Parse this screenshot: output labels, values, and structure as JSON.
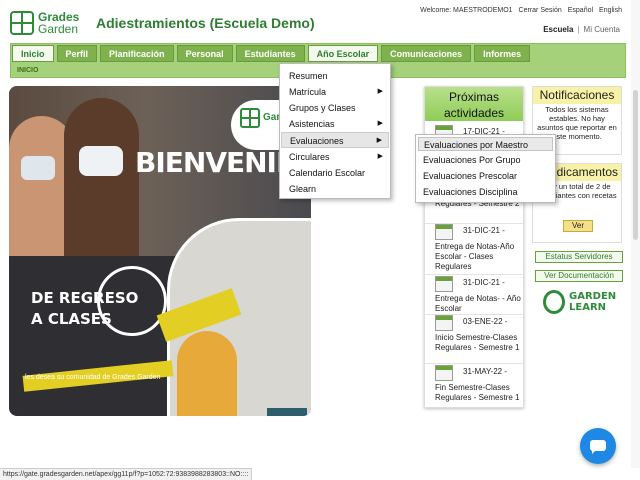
{
  "header": {
    "logo_line1": "Grades",
    "logo_line2": "Garden",
    "title": "Adiestramientos (Escuela Demo)",
    "welcome": "Welcome: MAESTRODEMO1",
    "logout": "Cerrar Sesión",
    "lang_es": "Español",
    "lang_en": "English",
    "school": "Escuela",
    "separator": "|",
    "my_account": "Mi Cuenta"
  },
  "nav": {
    "tabs": [
      {
        "label": "Inicio",
        "state": "active"
      },
      {
        "label": "Perfil"
      },
      {
        "label": "Planificación"
      },
      {
        "label": "Personal"
      },
      {
        "label": "Estudiantes"
      },
      {
        "label": "Año Escolar",
        "state": "open"
      },
      {
        "label": "Comunicaciones"
      },
      {
        "label": "Informes"
      }
    ],
    "breadcrumb": "INICIO"
  },
  "hero": {
    "welcome_text": "BIENVENIDO",
    "watermark_text": "Gar",
    "headline_line1": "DE REGRESO",
    "headline_line2": "A CLASES",
    "tagline": "les desea su comunidad de Grades Garden"
  },
  "activities": {
    "title_line1": "Próximas",
    "title_line2": "actividades",
    "items": [
      {
        "date": "17-DIC-21 -",
        "desc": ""
      },
      {
        "date": "",
        "desc": "Regulares - Semestre 2"
      },
      {
        "date": "31-DIC-21 -",
        "desc": "Entrega de Notas-Año Escolar - Clases Regulares"
      },
      {
        "date": "31-DIC-21 -",
        "desc": "Entrega de Notas- - Año Escolar"
      },
      {
        "date": "03-ENE-22 -",
        "desc": "Inicio Semestre-Clases Regulares - Semestre 1"
      },
      {
        "date": "31-MAY-22 -",
        "desc": "Fin Semestre-Clases Regulares - Semestre 1"
      }
    ]
  },
  "notifications": {
    "title": "Notificaciones",
    "body": "Todos los sistemas estables. No hay asuntos que reportar en este momento."
  },
  "medications": {
    "title": "edicamentos",
    "body": "Hay un total de 2 de estudiantes con recetas",
    "button": "Ver"
  },
  "side_buttons": {
    "server_status": "Estatus Servidores",
    "docs": "Ver Documentación"
  },
  "garden_learn": {
    "line1": "GARDEN",
    "line2": "LEARN"
  },
  "menu": {
    "items": [
      {
        "label": "Resumen",
        "arrow": ""
      },
      {
        "label": "Matrícula",
        "arrow": "▶"
      },
      {
        "label": "Grupos y Clases",
        "arrow": ""
      },
      {
        "label": "Asistencias",
        "arrow": "▶"
      },
      {
        "label": "Evaluaciones",
        "arrow": "▶"
      },
      {
        "label": "Circulares",
        "arrow": "▶"
      },
      {
        "label": "Calendario Escolar",
        "arrow": ""
      },
      {
        "label": "Glearn",
        "arrow": ""
      }
    ]
  },
  "submenu": {
    "items": [
      "Evaluaciones por Maestro",
      "Evaluaciones Por Grupo",
      "Evaluaciones Prescolar",
      "Evaluaciones Disciplina"
    ]
  },
  "status_bar": "https://gate.gradesgarden.net/apex/gg11p/f?p=1052:72:9383988283803::NO::::",
  "icons": {
    "chat": "chat-bubble-icon",
    "calendar": "calendar-icon",
    "submenu_arrow": "chevron-right-icon"
  },
  "colors": {
    "brand_green": "#2e8b3a",
    "nav_green": "#a4d17a",
    "tab_green": "#7fb24f",
    "notice_yellow": "#f8f2a8",
    "chat_blue": "#1e88e5"
  }
}
